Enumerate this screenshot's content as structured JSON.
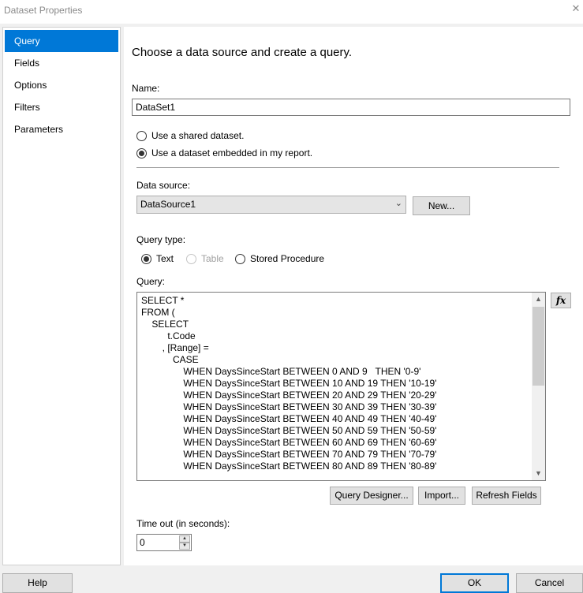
{
  "window": {
    "title": "Dataset Properties",
    "close_glyph": "✕"
  },
  "sidebar": {
    "items": [
      {
        "label": "Query",
        "selected": true
      },
      {
        "label": "Fields",
        "selected": false
      },
      {
        "label": "Options",
        "selected": false
      },
      {
        "label": "Filters",
        "selected": false
      },
      {
        "label": "Parameters",
        "selected": false
      }
    ]
  },
  "main": {
    "heading": "Choose a data source and create a query.",
    "name_label": "Name:",
    "name_value": "DataSet1",
    "radio_shared": "Use a shared dataset.",
    "radio_embedded": "Use a dataset embedded in my report.",
    "datasource_label": "Data source:",
    "datasource_value": "DataSource1",
    "new_button": "New...",
    "query_type_label": "Query type:",
    "query_type_options": {
      "text": "Text",
      "table": "Table",
      "stored_procedure": "Stored Procedure"
    },
    "query_label": "Query:",
    "query_lines": [
      "SELECT *",
      "FROM (",
      "    SELECT",
      "          t.Code",
      "        , [Range] =",
      "            CASE",
      "                WHEN DaysSinceStart BETWEEN 0 AND 9   THEN '0-9'",
      "                WHEN DaysSinceStart BETWEEN 10 AND 19 THEN '10-19'",
      "                WHEN DaysSinceStart BETWEEN 20 AND 29 THEN '20-29'",
      "                WHEN DaysSinceStart BETWEEN 30 AND 39 THEN '30-39'",
      "                WHEN DaysSinceStart BETWEEN 40 AND 49 THEN '40-49'",
      "                WHEN DaysSinceStart BETWEEN 50 AND 59 THEN '50-59'",
      "                WHEN DaysSinceStart BETWEEN 60 AND 69 THEN '60-69'",
      "                WHEN DaysSinceStart BETWEEN 70 AND 79 THEN '70-79'",
      "                WHEN DaysSinceStart BETWEEN 80 AND 89 THEN '80-89'"
    ],
    "fx_label": "fx",
    "query_designer_button": "Query Designer...",
    "import_button": "Import...",
    "refresh_fields_button": "Refresh Fields",
    "timeout_label": "Time out (in seconds):",
    "timeout_value": "0"
  },
  "footer": {
    "help_button": "Help",
    "ok_button": "OK",
    "cancel_button": "Cancel"
  },
  "colors": {
    "accent": "#0078d7",
    "background": "#f0f0f0"
  },
  "icons": {
    "close": "close-icon",
    "chevron": "chevron-down-icon",
    "fx": "function-icon"
  }
}
